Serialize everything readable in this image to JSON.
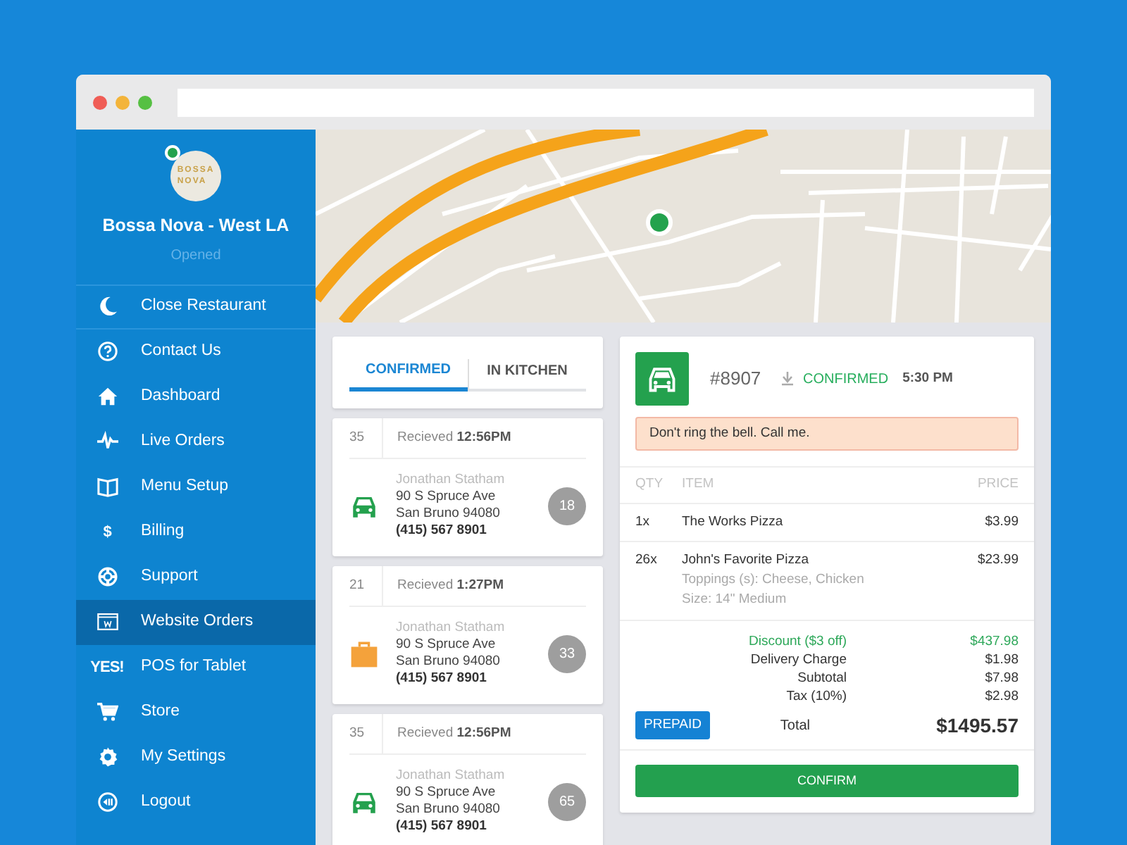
{
  "restaurant": {
    "logo_lines": [
      "BOSSA",
      "NOVA"
    ],
    "online": true,
    "name": "Bossa Nova - West LA",
    "status": "Opened"
  },
  "sidebar": {
    "items": [
      {
        "label": "Close Restaurant",
        "kind": "moon",
        "selected": false,
        "separated": true
      },
      {
        "label": "Contact Us",
        "kind": "question",
        "selected": false,
        "separated": false
      },
      {
        "label": "Dashboard",
        "kind": "home",
        "selected": false,
        "separated": false
      },
      {
        "label": "Live Orders",
        "kind": "pulse",
        "selected": false,
        "separated": false
      },
      {
        "label": "Menu Setup",
        "kind": "book",
        "selected": false,
        "separated": false
      },
      {
        "label": "Billing",
        "icon_text": "$",
        "selected": false,
        "separated": false
      },
      {
        "label": "Support",
        "kind": "lifebuoy",
        "selected": false,
        "separated": false
      },
      {
        "label": "Website Orders",
        "kind": "browser",
        "selected": true,
        "separated": false
      },
      {
        "label": "POS for Tablet",
        "icon_text": "YES!",
        "selected": false,
        "separated": false
      },
      {
        "label": "Store",
        "kind": "cart",
        "selected": false,
        "separated": false
      },
      {
        "label": "My Settings",
        "kind": "gear",
        "selected": false,
        "separated": false
      },
      {
        "label": "Logout",
        "kind": "logout",
        "selected": false,
        "separated": false
      }
    ]
  },
  "tabs": [
    {
      "label": "CONFIRMED",
      "selected": true
    },
    {
      "label": "IN KITCHEN",
      "selected": false
    }
  ],
  "orders": [
    {
      "number": "35",
      "received": "Recieved **12:56PM**",
      "kind": "delivery",
      "customer": "Jonathan Statham",
      "address": "90 S Spruce Ave",
      "city": "San Bruno 94080",
      "phone": "(415) 567 8901",
      "count": "18"
    },
    {
      "number": "21",
      "received": "Recieved **1:27PM**",
      "kind": "pickup",
      "customer": "Jonathan Statham",
      "address": "90 S Spruce Ave",
      "city": "San Bruno 94080",
      "phone": "(415) 567 8901",
      "count": "33"
    },
    {
      "number": "35",
      "received": "Recieved **12:56PM**",
      "kind": "delivery",
      "customer": "Jonathan Statham",
      "address": "90 S Spruce Ave",
      "city": "San Bruno 94080",
      "phone": "(415) 567 8901",
      "count": "65"
    }
  ],
  "detail": {
    "kind": "delivery",
    "order_number": "#8907",
    "status": "CONFIRMED",
    "time": "5:30 PM",
    "note": "Don't ring the bell. Call me.",
    "columns": [
      "QTY",
      "ITEM",
      "PRICE"
    ],
    "items": [
      {
        "qty": "1x",
        "name": "The Works Pizza",
        "price": "$3.99"
      },
      {
        "qty": "26x",
        "name": "John's Favorite Pizza",
        "details": [
          "Toppings (s): Cheese, Chicken",
          "Size: 14\" Medium"
        ],
        "price": "$23.99"
      }
    ],
    "charges": [
      {
        "label": "Discount ($3 off)",
        "value": "$437.98",
        "kind": "discount"
      },
      {
        "label": "Delivery Charge",
        "value": "$1.98",
        "kind": "normal"
      },
      {
        "label": "Subtotal",
        "value": "$7.98",
        "kind": "normal"
      },
      {
        "label": "Tax (10%)",
        "value": "$2.98",
        "kind": "normal"
      }
    ],
    "payment_badge": "PREPAID",
    "total_label": "Total",
    "total": "$1495.57",
    "confirm_button": "CONFIRM"
  }
}
